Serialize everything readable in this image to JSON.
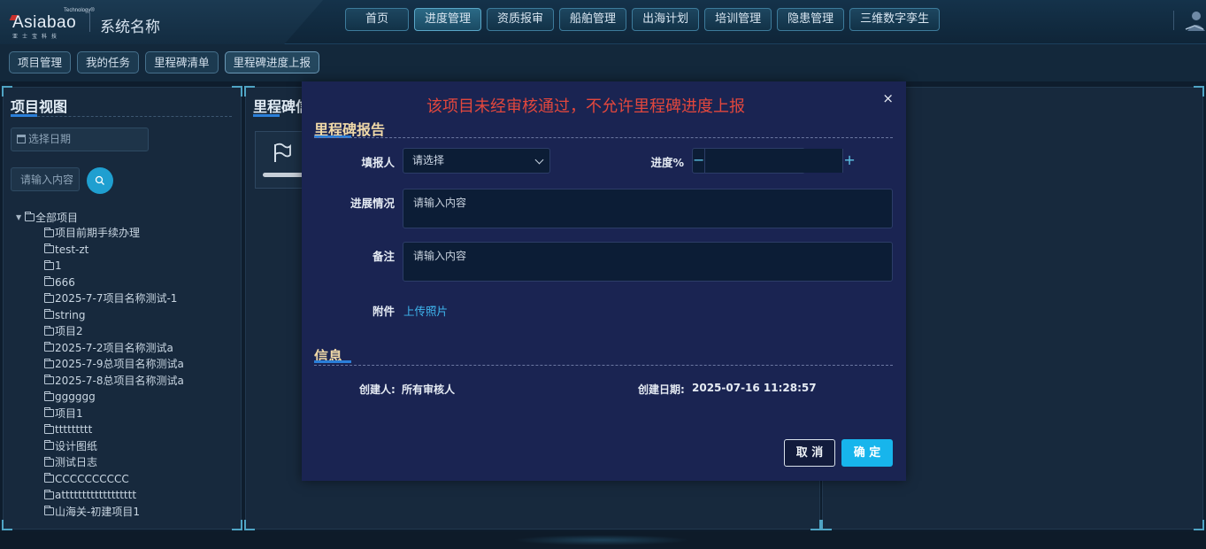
{
  "header": {
    "logo_top": "Technology®",
    "logo_main": "Asiabao",
    "logo_sub": "亚士宝科技",
    "system_name": "系统名称",
    "nav": [
      {
        "label": "首页"
      },
      {
        "label": "进度管理"
      },
      {
        "label": "资质报审"
      },
      {
        "label": "船舶管理"
      },
      {
        "label": "出海计划"
      },
      {
        "label": "培训管理"
      },
      {
        "label": "隐患管理"
      },
      {
        "label": "三维数字孪生"
      }
    ],
    "active_nav": "进度管理"
  },
  "subnav": {
    "items": [
      {
        "label": "项目管理"
      },
      {
        "label": "我的任务"
      },
      {
        "label": "里程碑清单"
      },
      {
        "label": "里程碑进度上报"
      }
    ],
    "active": "里程碑进度上报"
  },
  "left_panel": {
    "title": "项目视图",
    "date_placeholder": "选择日期",
    "search_placeholder": "请输入内容",
    "tree_root": "全部项目",
    "tree_items": [
      "项目前期手续办理",
      "test-zt",
      "1",
      "666",
      "2025-7-7项目名称测试-1",
      "string",
      "项目2",
      "2025-7-2项目名称测试a",
      "2025-7-9总项目名称测试a",
      "2025-7-8总项目名称测试a",
      "gggggg",
      "项目1",
      "ttttttttt",
      "设计图纸",
      "测试日志",
      "CCCCCCCCCC",
      "atttttttttttttttttt",
      "山海关-初建项目1"
    ]
  },
  "mid_panel": {
    "title": "里程碑信"
  },
  "modal": {
    "alert": "该项目未经审核通过，不允许里程碑进度上报",
    "close": "×",
    "section_report": "里程碑报告",
    "reporter_label": "填报人",
    "reporter_placeholder": "请选择",
    "progress_label": "进度%",
    "progress_value": "",
    "status_label": "进展情况",
    "status_placeholder": "请输入内容",
    "remark_label": "备注",
    "remark_placeholder": "请输入内容",
    "attachment_label": "附件",
    "upload_text": "上传照片",
    "section_info": "信息",
    "creator_label": "创建人:",
    "creator_value": "所有审核人",
    "created_date_label": "创建日期:",
    "created_date_value": "2025-07-16 11:28:57",
    "cancel_label": "取 消",
    "ok_label": "确 定"
  },
  "colors": {
    "accent": "#17b5ec",
    "alert": "#e2473d",
    "section_title": "#f0d9a8",
    "modal_bg": "#1a2452"
  },
  "icons": [
    "calendar-icon",
    "search-icon",
    "caret-down-icon",
    "folder-icon",
    "flag-icon",
    "chevron-down-icon",
    "minus-icon",
    "plus-icon",
    "close-icon",
    "user-icon"
  ]
}
